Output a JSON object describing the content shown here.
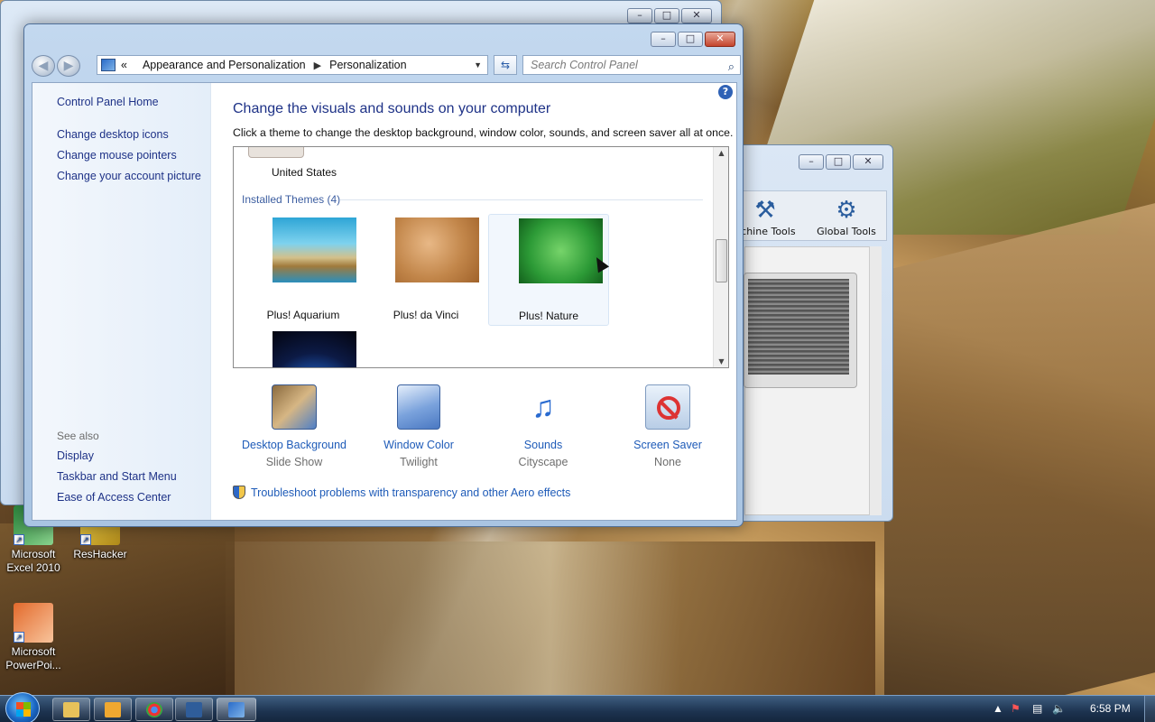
{
  "control_panel": {
    "breadcrumb": {
      "chevrons": "«",
      "part1": "Appearance and Personalization",
      "part2": "Personalization"
    },
    "search_placeholder": "Search Control Panel",
    "left_links": [
      "Control Panel Home",
      "Change desktop icons",
      "Change mouse pointers",
      "Change your account picture"
    ],
    "see_also_label": "See also",
    "see_also_links": [
      "Display",
      "Taskbar and Start Menu",
      "Ease of Access Center"
    ],
    "heading": "Change the visuals and sounds on your computer",
    "subheading": "Click a theme to change the desktop background, window color, sounds, and screen saver all at once.",
    "top_theme_label": "United States",
    "installed_themes_label": "Installed Themes (4)",
    "themes": [
      {
        "label": "Plus! Aquarium"
      },
      {
        "label": "Plus! da Vinci"
      },
      {
        "label": "Plus! Nature",
        "selected": true
      }
    ],
    "tiles": [
      {
        "name": "Desktop Background",
        "value": "Slide Show",
        "icon": "desktop-background-icon"
      },
      {
        "name": "Window Color",
        "value": "Twilight",
        "icon": "window-color-icon"
      },
      {
        "name": "Sounds",
        "value": "Cityscape",
        "icon": "sounds-icon"
      },
      {
        "name": "Screen Saver",
        "value": "None",
        "icon": "screen-saver-icon"
      }
    ],
    "troubleshoot_link": "Troubleshoot problems with transparency and other Aero effects"
  },
  "background_window": {
    "tools": [
      {
        "label": "achine Tools"
      },
      {
        "label": "Global Tools"
      }
    ]
  },
  "desktop_icons": [
    {
      "label_line1": "Microsoft",
      "label_line2": "Excel 2010"
    },
    {
      "label_line1": "ResHacker",
      "label_line2": ""
    },
    {
      "label_line1": "Microsoft",
      "label_line2": "PowerPoi..."
    }
  ],
  "taskbar": {
    "clock": "6:58 PM"
  },
  "colors": {
    "link_blue": "#1e3287",
    "tile_link_blue": "#1e5bb8"
  }
}
